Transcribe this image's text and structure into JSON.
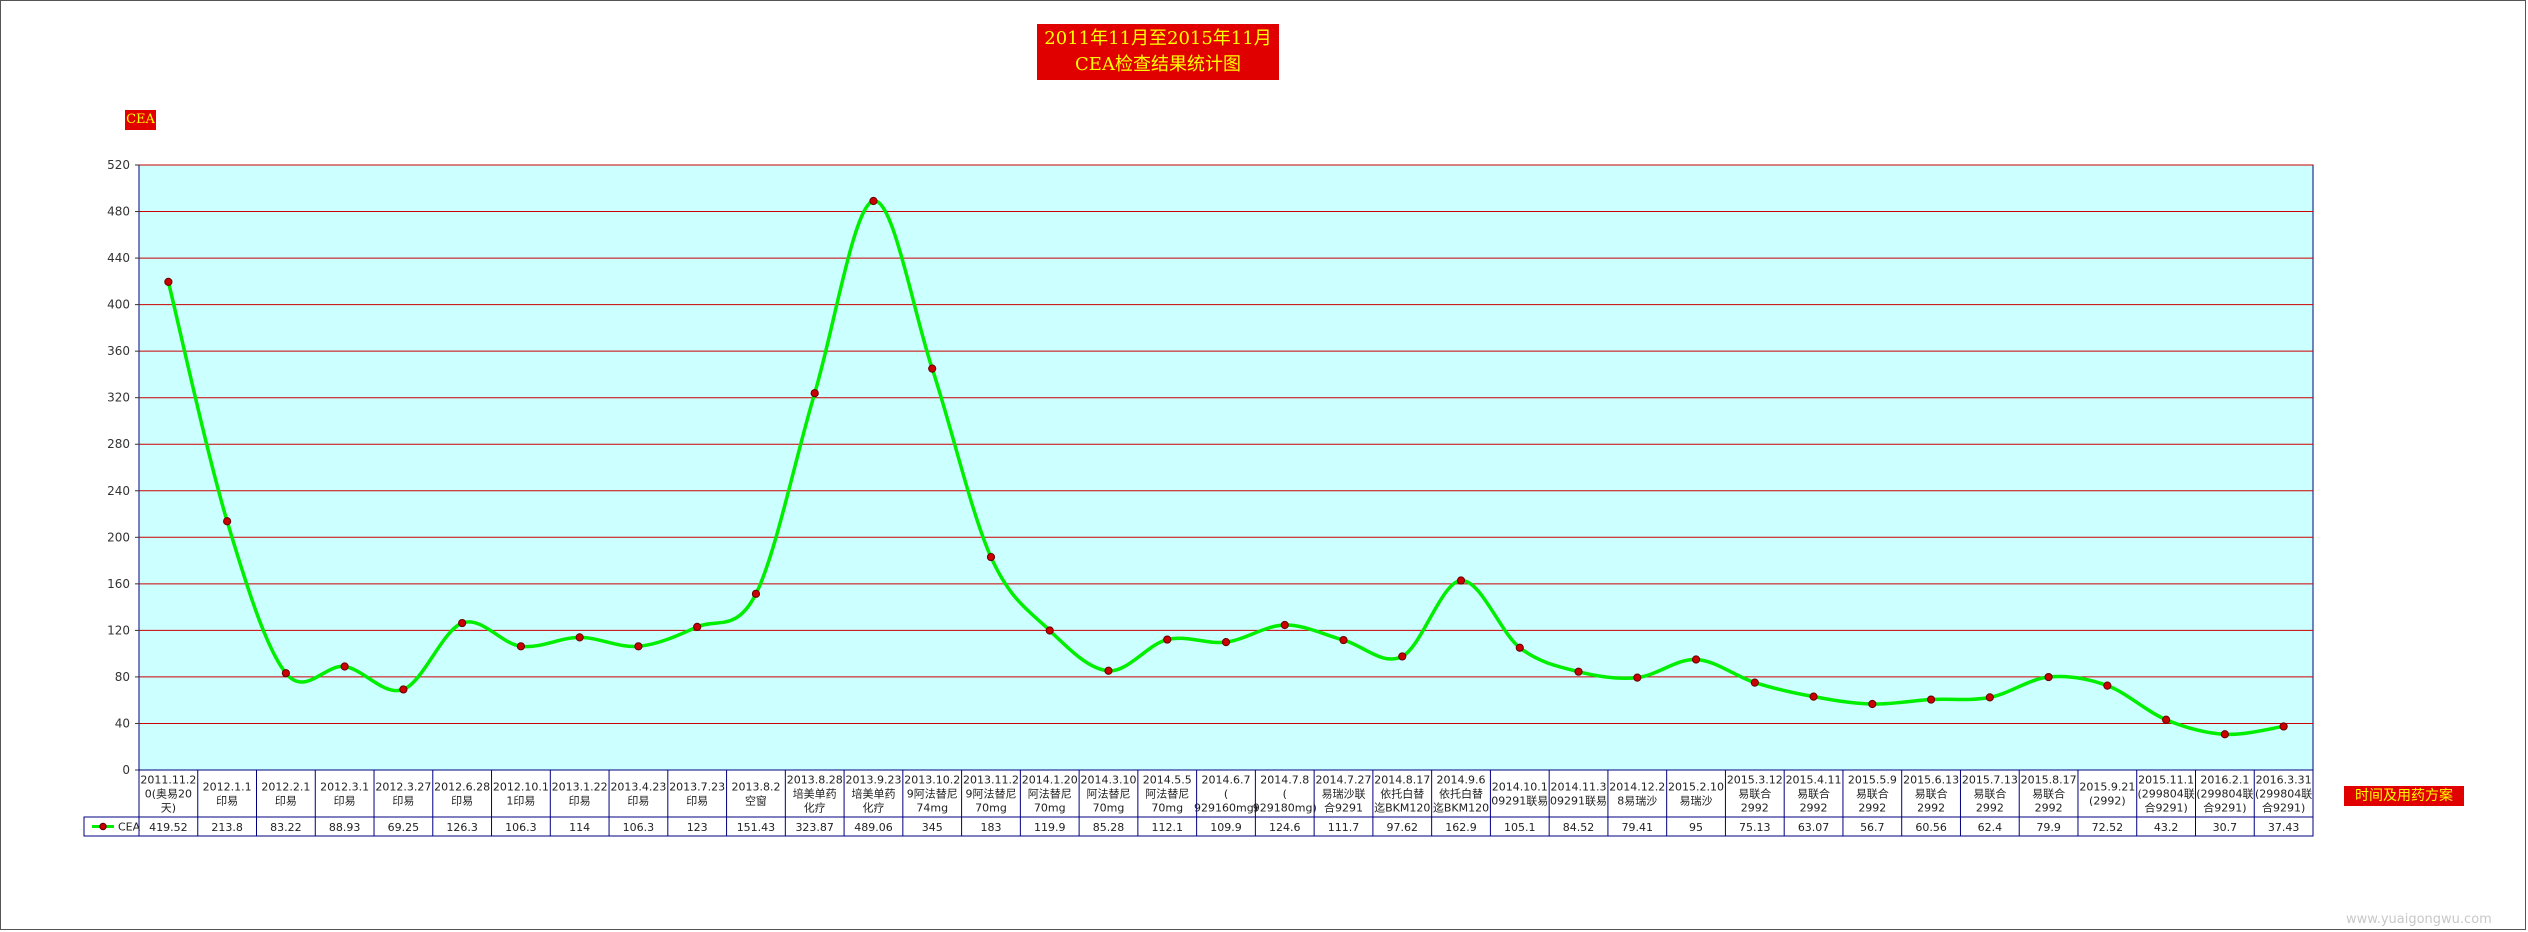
{
  "chart_data": {
    "type": "line",
    "title_line1": "2011年11月至2015年11月",
    "title_line2": "CEA检查结果统计图",
    "ylabel": "CEA",
    "xlabel": "时间及用药方案",
    "ylim": [
      0,
      520
    ],
    "yticks": [
      "0",
      "40",
      "80",
      "120",
      "160",
      "200",
      "240",
      "280",
      "320",
      "360",
      "400",
      "440",
      "480",
      "520"
    ],
    "grid": true,
    "legend_position": "bottom-left",
    "series": [
      {
        "name": "CEA",
        "color": "#00ee00",
        "marker_color": "#cc0000",
        "values": [
          419.52,
          213.8,
          83.22,
          88.93,
          69.25,
          126.3,
          106.3,
          114,
          106.3,
          123,
          151.43,
          323.87,
          489.06,
          345,
          183,
          119.9,
          85.28,
          112.1,
          109.9,
          124.6,
          111.7,
          97.62,
          162.9,
          105.1,
          84.52,
          79.41,
          95,
          75.13,
          63.07,
          56.7,
          60.56,
          62.4,
          79.9,
          72.52,
          43.2,
          30.7,
          37.43
        ],
        "value_labels": [
          "419.52",
          "213.8",
          "83.22",
          "88.93",
          "69.25",
          "126.3",
          "106.3",
          "114",
          "106.3",
          "123",
          "151.43",
          "323.87",
          "489.06",
          "345",
          "183",
          "119.9",
          "85.28",
          "112.1",
          "109.9",
          "124.6",
          "111.7",
          "97.62",
          "162.9",
          "105.1",
          "84.52",
          "79.41",
          "95",
          "75.13",
          "63.07",
          "56.7",
          "60.56",
          "62.4",
          "79.9",
          "72.52",
          "43.2",
          "30.7",
          "37.43"
        ]
      }
    ],
    "categories": [
      [
        "2011.11.2",
        "0(奥易20",
        "天)"
      ],
      [
        "2012.1.1",
        "印易"
      ],
      [
        "2012.2.1",
        "印易"
      ],
      [
        "2012.3.1",
        "印易"
      ],
      [
        "2012.3.27",
        "印易"
      ],
      [
        "2012.6.28",
        "印易"
      ],
      [
        "2012.10.1",
        "1印易"
      ],
      [
        "2013.1.22",
        "印易"
      ],
      [
        "2013.4.23",
        "印易"
      ],
      [
        "2013.7.23",
        "印易"
      ],
      [
        "2013.8.2",
        "空窗"
      ],
      [
        "2013.8.28",
        "培美单药",
        "化疗"
      ],
      [
        "2013.9.23",
        "培美单药",
        "化疗"
      ],
      [
        "2013.10.2",
        "9阿法替尼",
        "74mg"
      ],
      [
        "2013.11.2",
        "9阿法替尼",
        "70mg"
      ],
      [
        "2014.1.20",
        "阿法替尼",
        "70mg"
      ],
      [
        "2014.3.10",
        "阿法替尼",
        "70mg"
      ],
      [
        "2014.5.5",
        "阿法替尼",
        "70mg"
      ],
      [
        "2014.6.7",
        "(",
        "929160mg)"
      ],
      [
        "2014.7.8",
        "(",
        "929180mg)"
      ],
      [
        "2014.7.27",
        "易瑞沙联",
        "合9291"
      ],
      [
        "2014.8.17",
        "依托白替",
        "迄BKM120"
      ],
      [
        "2014.9.6",
        "依托白替",
        "迄BKM120"
      ],
      [
        "2014.10.1",
        "09291联易"
      ],
      [
        "2014.11.3",
        "09291联易"
      ],
      [
        "2014.12.2",
        "8易瑞沙"
      ],
      [
        "2015.2.10",
        "易瑞沙"
      ],
      [
        "2015.3.12",
        "易联合",
        "2992"
      ],
      [
        "2015.4.11",
        "易联合",
        "2992"
      ],
      [
        "2015.5.9",
        "易联合",
        "2992"
      ],
      [
        "2015.6.13",
        "易联合",
        "2992"
      ],
      [
        "2015.7.13",
        "易联合",
        "2992"
      ],
      [
        "2015.8.17",
        "易联合",
        "2992"
      ],
      [
        "2015.9.21",
        "(2992)"
      ],
      [
        "2015.11.1",
        "(299804联",
        "合9291)"
      ],
      [
        "2016.2.1",
        "(299804联",
        "合9291)"
      ],
      [
        "2016.3.31",
        "(299804联",
        "合9291)"
      ]
    ]
  },
  "colors": {
    "plot_background": "#ccffff",
    "gridline": "#cc0000",
    "table_border": "#000080",
    "title_background": "#e00000",
    "title_text": "#ffff00"
  },
  "watermark": "www.yuaigongwu.com"
}
